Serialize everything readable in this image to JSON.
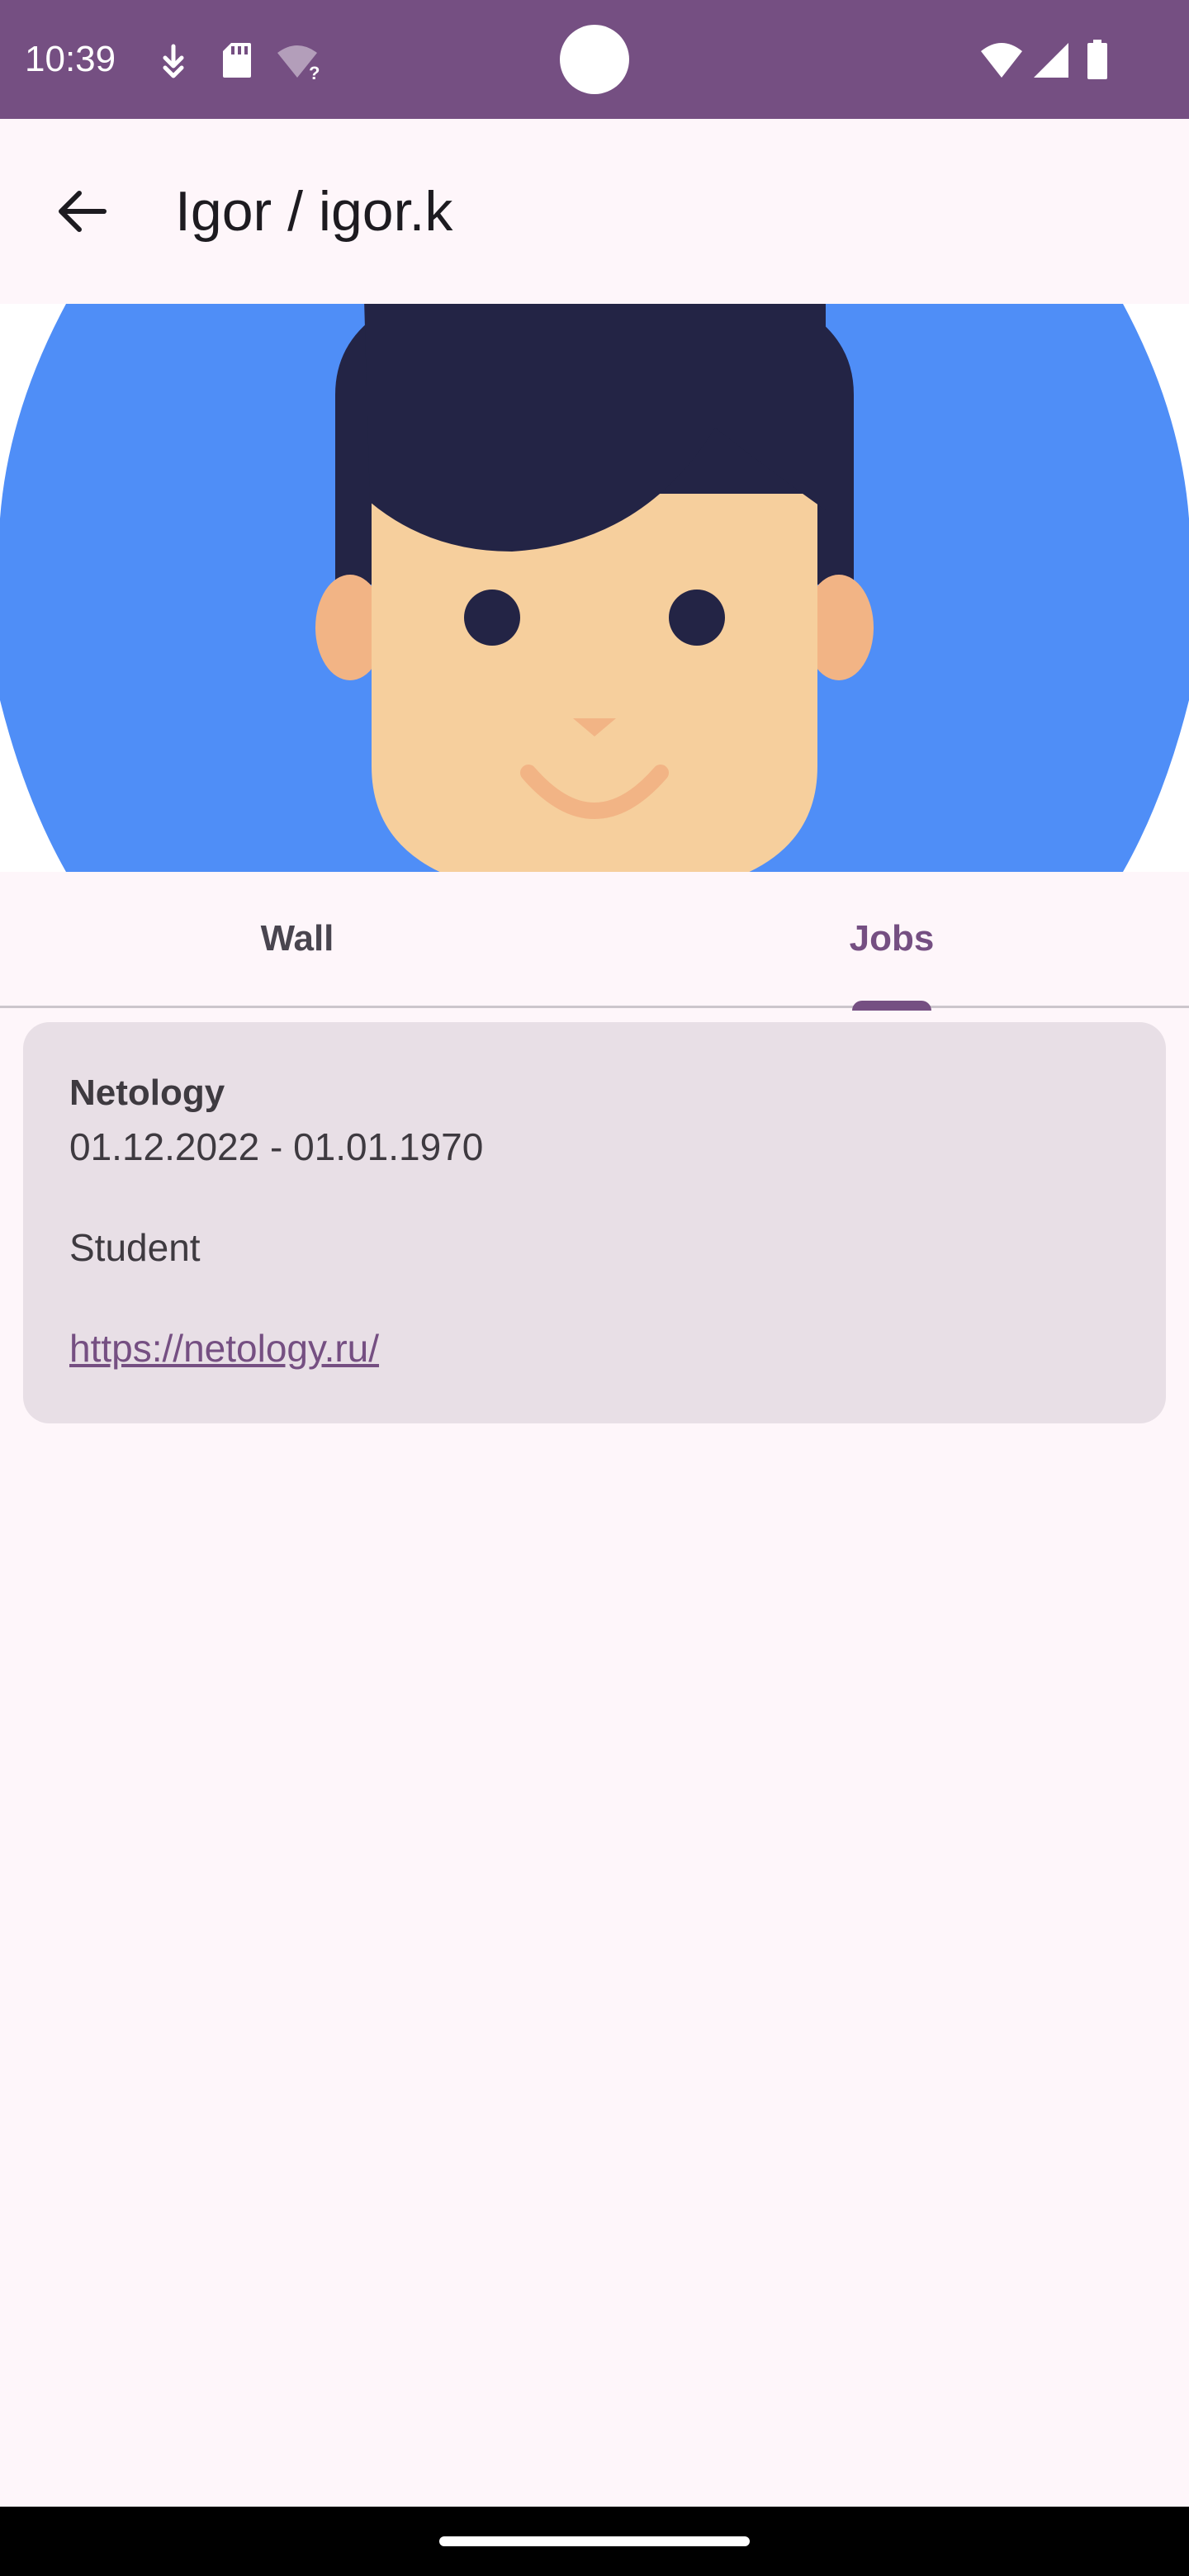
{
  "status_bar": {
    "time": "10:39",
    "left_icons": [
      "download-icon",
      "sd-card-icon",
      "wifi-unknown-icon"
    ],
    "right_icons": [
      "wifi-icon",
      "cellular-signal-icon",
      "battery-icon"
    ],
    "background_color": "#754F82"
  },
  "app_bar": {
    "back_icon": "arrow-back-icon",
    "title": "Igor / igor.k"
  },
  "avatar": {
    "icon": "user-avatar-illustration",
    "background_color": "#4F8EF7"
  },
  "tabs": [
    {
      "label": "Wall",
      "selected": false
    },
    {
      "label": "Jobs",
      "selected": true
    }
  ],
  "jobs": [
    {
      "company": "Netology",
      "dates": "01.12.2022 - 01.01.1970",
      "position": "Student",
      "link": "https://netology.ru/"
    }
  ],
  "colors": {
    "accent": "#754F82",
    "surface": "#FEF6FA",
    "card": "#E8DFE6"
  }
}
